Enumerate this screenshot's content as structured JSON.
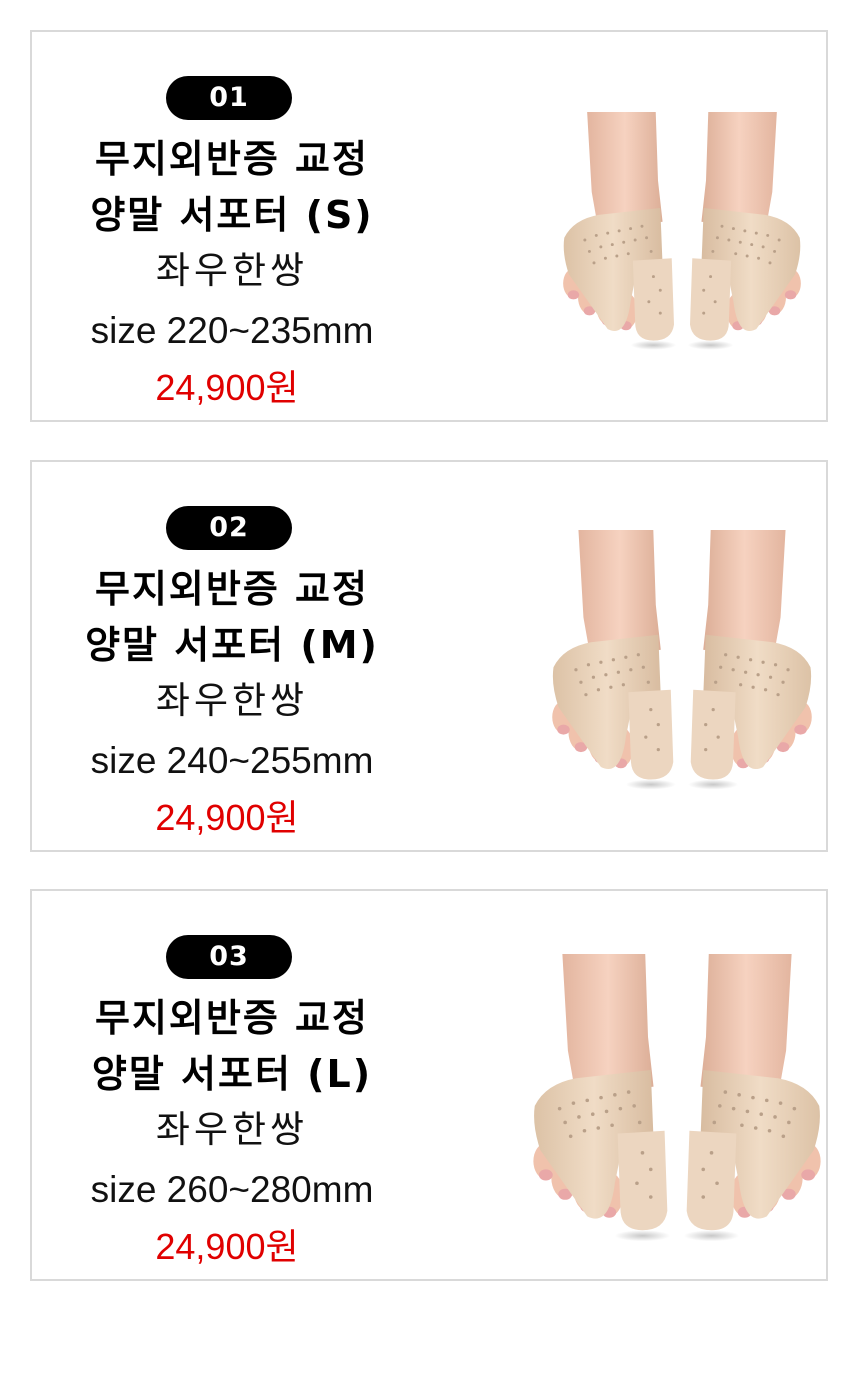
{
  "products": [
    {
      "number": "01",
      "title_line1": "무지외반증 교정",
      "title_line2": "양말 서포터 (S)",
      "pair_label": "좌우한쌍",
      "size": "size 220~235mm",
      "price": "24,900원"
    },
    {
      "number": "02",
      "title_line1": "무지외반증 교정",
      "title_line2": "양말 서포터 (M)",
      "pair_label": "좌우한쌍",
      "size": "size 240~255mm",
      "price": "24,900원"
    },
    {
      "number": "03",
      "title_line1": "무지외반증 교정",
      "title_line2": "양말 서포터 (L)",
      "pair_label": "좌우한쌍",
      "size": "size 260~280mm",
      "price": "24,900원"
    }
  ],
  "colors": {
    "badge_background": "#000000",
    "badge_text": "#ffffff",
    "price": "#e00000",
    "card_border": "#d9d9d9",
    "skin": "#f2c9b4",
    "support": "#ead2b9"
  }
}
